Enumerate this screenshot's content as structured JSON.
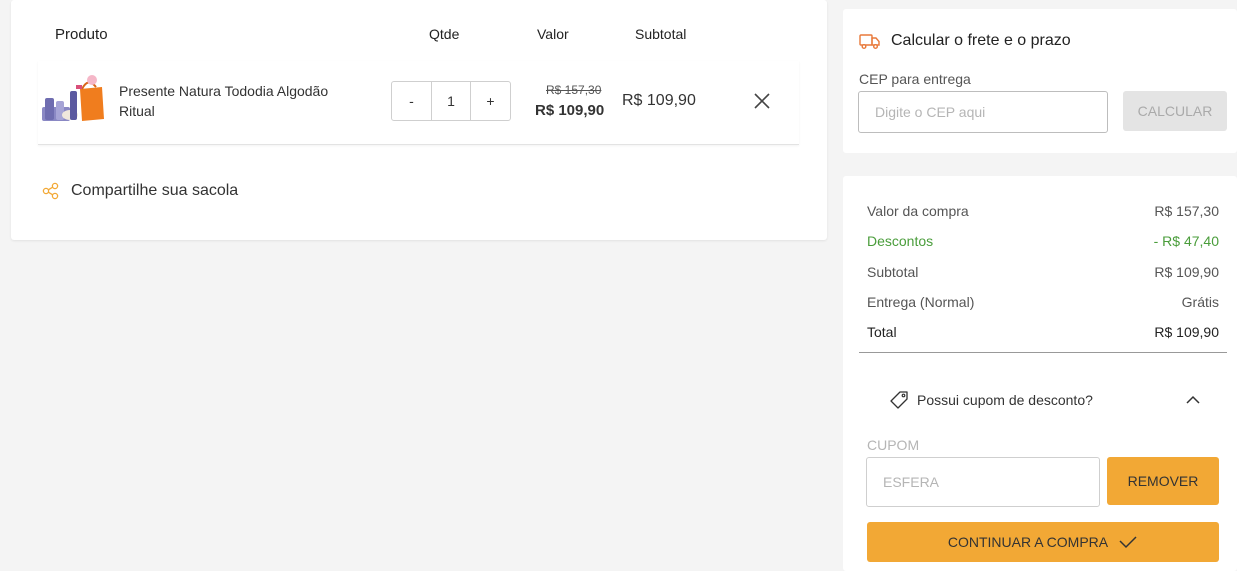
{
  "cart": {
    "headers": {
      "product": "Produto",
      "qty": "Qtde",
      "value": "Valor",
      "subtotal": "Subtotal"
    },
    "item": {
      "name": "Presente Natura Tododia Algodão Ritual",
      "quantity": "1",
      "decrement_label": "-",
      "increment_label": "+",
      "old_price": "R$ 157,30",
      "price": "R$ 109,90",
      "subtotal": "R$ 109,90"
    },
    "share_label": "Compartilhe sua sacola"
  },
  "shipping": {
    "title": "Calcular o frete e o prazo",
    "cep_label": "CEP para entrega",
    "cep_placeholder": "Digite o CEP aqui",
    "calculate_label": "CALCULAR"
  },
  "summary": {
    "rows": [
      {
        "label": "Valor da compra",
        "value": "R$ 157,30"
      },
      {
        "label": "Descontos",
        "value": "- R$ 47,40"
      },
      {
        "label": "Subtotal",
        "value": "R$ 109,90"
      },
      {
        "label": "Entrega (Normal)",
        "value": "Grátis"
      },
      {
        "label": "Total",
        "value": "R$ 109,90"
      }
    ],
    "coupon_toggle_label": "Possui cupom de desconto?",
    "coupon_label": "CUPOM",
    "coupon_value": "ESFERA",
    "remove_label": "REMOVER",
    "continue_label": "CONTINUAR A COMPRA"
  },
  "colors": {
    "accent": "#f2a835",
    "shipping_icon": "#e8793a",
    "discount": "#4a9d3b"
  },
  "icons": {
    "truck": "truck-icon",
    "share": "share-icon",
    "remove": "close-icon",
    "tag": "tag-icon",
    "chevron": "chevron-up-icon",
    "check": "check-icon"
  }
}
